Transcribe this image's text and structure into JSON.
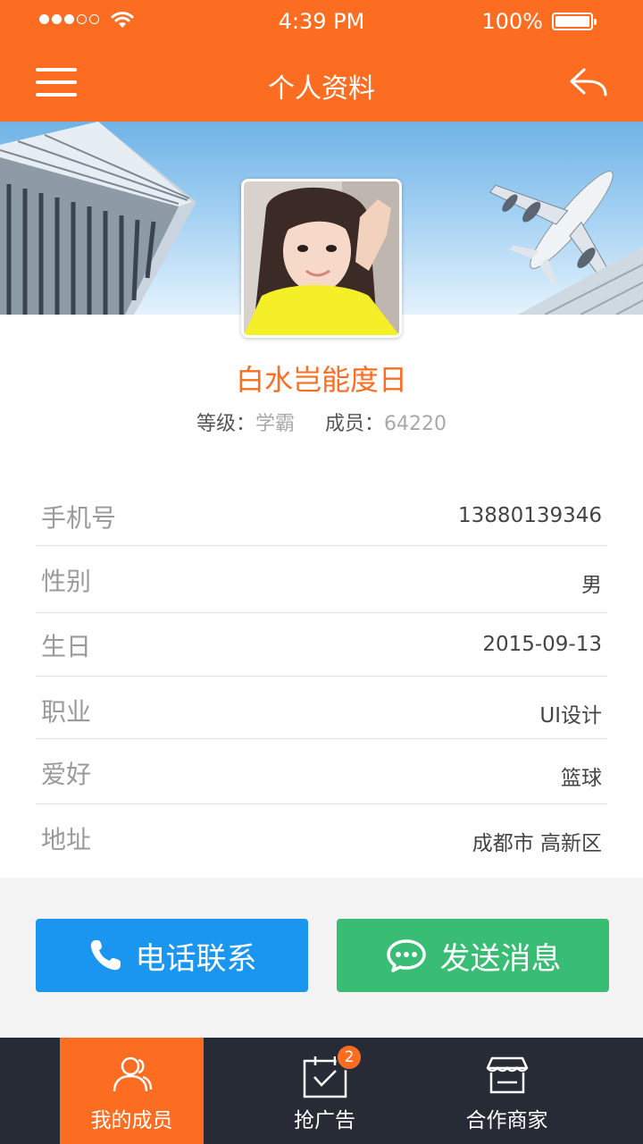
{
  "status_bar": {
    "time": "4:39 PM",
    "battery": "100%"
  },
  "nav": {
    "title": "个人资料",
    "menu_icon": "hamburger-icon",
    "back_icon": "return-arrow-icon"
  },
  "profile": {
    "name": "白水岂能度日",
    "level_label": "等级：",
    "level_value": "学霸",
    "member_label": "成员：",
    "member_value": "64220"
  },
  "info": [
    {
      "label": "手机号",
      "value": "13880139346"
    },
    {
      "label": "性别",
      "value": "男"
    },
    {
      "label": "生日",
      "value": "2015-09-13"
    },
    {
      "label": "职业",
      "value": "UI设计"
    },
    {
      "label": "爱好",
      "value": "篮球"
    },
    {
      "label": "地址",
      "value": "成都市 高新区"
    }
  ],
  "actions": {
    "call": "电话联系",
    "message": "发送消息"
  },
  "tabs": [
    {
      "label": "我的成员",
      "icon": "members-icon",
      "active": true
    },
    {
      "label": "抢广告",
      "icon": "calendar-check-icon",
      "badge": "2"
    },
    {
      "label": "合作商家",
      "icon": "store-icon"
    }
  ],
  "colors": {
    "accent": "#fc6d21",
    "call": "#1b96f0",
    "message": "#39bd74",
    "tabbar": "#262b36"
  }
}
